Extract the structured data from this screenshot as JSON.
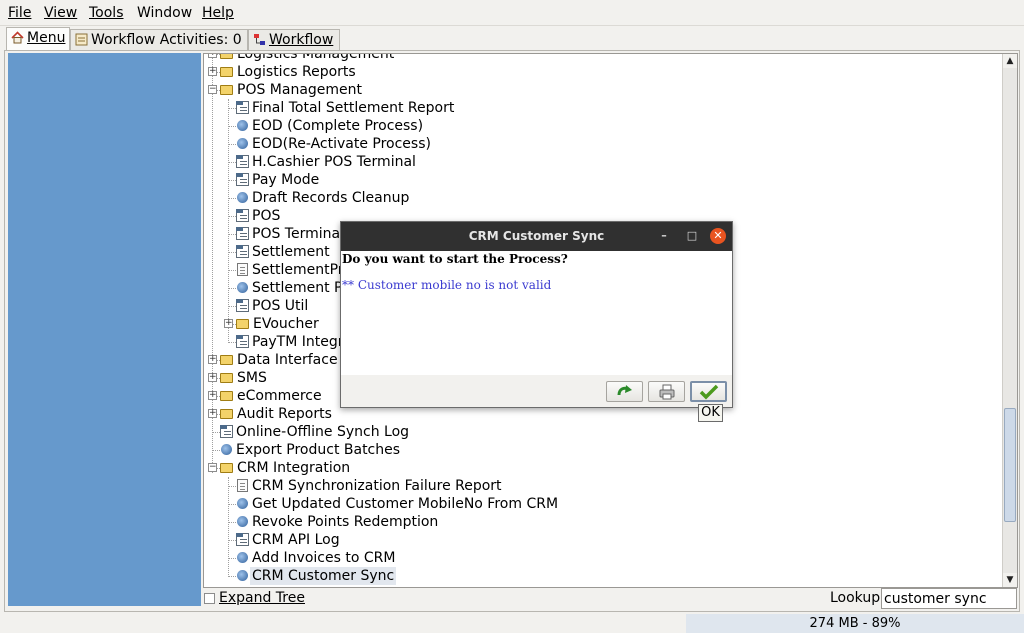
{
  "menubar": {
    "file": "File",
    "view": "View",
    "tools": "Tools",
    "window": "Window",
    "help": "Help"
  },
  "tabs": {
    "menu": "Menu",
    "workflow_activities": "Workflow Activities: 0",
    "workflow": "Workflow"
  },
  "tree": {
    "items": [
      {
        "label": "Logistics Management",
        "icon": "folder-icon"
      },
      {
        "label": "Logistics Reports",
        "icon": "folder-icon"
      },
      {
        "label": "POS Management",
        "icon": "folder-open-icon"
      },
      {
        "label": "Final Total Settlement Report",
        "icon": "window-icon"
      },
      {
        "label": "EOD (Complete Process)",
        "icon": "process-icon"
      },
      {
        "label": "EOD(Re-Activate Process)",
        "icon": "process-icon"
      },
      {
        "label": "H.Cashier POS Terminal",
        "icon": "window-icon"
      },
      {
        "label": "Pay Mode",
        "icon": "window-icon"
      },
      {
        "label": "Draft Records Cleanup",
        "icon": "process-icon"
      },
      {
        "label": "POS",
        "icon": "window-icon"
      },
      {
        "label": "POS Terminal",
        "icon": "window-icon"
      },
      {
        "label": "Settlement",
        "icon": "window-icon"
      },
      {
        "label": "SettlementPr",
        "icon": "report-icon"
      },
      {
        "label": "Settlement Pr",
        "icon": "process-icon"
      },
      {
        "label": "POS Util",
        "icon": "window-icon"
      },
      {
        "label": "EVoucher",
        "icon": "folder-icon"
      },
      {
        "label": "PayTM Integra",
        "icon": "window-icon"
      },
      {
        "label": "Data Interface",
        "icon": "folder-icon"
      },
      {
        "label": "SMS",
        "icon": "folder-icon"
      },
      {
        "label": "eCommerce",
        "icon": "folder-icon"
      },
      {
        "label": "Audit Reports",
        "icon": "folder-icon"
      },
      {
        "label": "Online-Offline Synch Log",
        "icon": "window-icon"
      },
      {
        "label": "Export Product Batches",
        "icon": "process-icon"
      },
      {
        "label": "CRM Integration",
        "icon": "folder-open-icon"
      },
      {
        "label": "CRM Synchronization Failure Report",
        "icon": "report-icon"
      },
      {
        "label": "Get Updated Customer MobileNo From CRM",
        "icon": "process-icon"
      },
      {
        "label": "Revoke Points Redemption",
        "icon": "process-icon"
      },
      {
        "label": "CRM API Log",
        "icon": "window-icon"
      },
      {
        "label": "Add Invoices to CRM",
        "icon": "process-icon"
      },
      {
        "label": "CRM Customer Sync",
        "icon": "process-icon"
      }
    ]
  },
  "bottom": {
    "expand_tree": "Expand Tree",
    "lookup": "Lookup",
    "lookup_value": "customer sync"
  },
  "status": {
    "memory": "274 MB - 89%"
  },
  "dialog": {
    "title": "CRM Customer Sync",
    "question": "Do you want to start the Process?",
    "info": "** Customer mobile no is not valid",
    "tooltip": "OK"
  }
}
